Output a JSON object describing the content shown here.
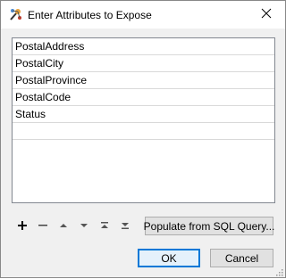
{
  "window": {
    "title": "Enter Attributes to Expose",
    "app_icon": "fme-workbench-icon",
    "close_icon": "close-icon"
  },
  "attributes": [
    "PostalAddress",
    "PostalCity",
    "PostalProvince",
    "PostalCode",
    "Status"
  ],
  "toolbar": {
    "icons": [
      "plus-icon",
      "minus-icon",
      "move-up-icon",
      "move-down-icon",
      "move-to-top-icon",
      "move-to-bottom-icon"
    ],
    "populate_label": "Populate from SQL Query..."
  },
  "buttons": {
    "ok_label": "OK",
    "cancel_label": "Cancel"
  }
}
